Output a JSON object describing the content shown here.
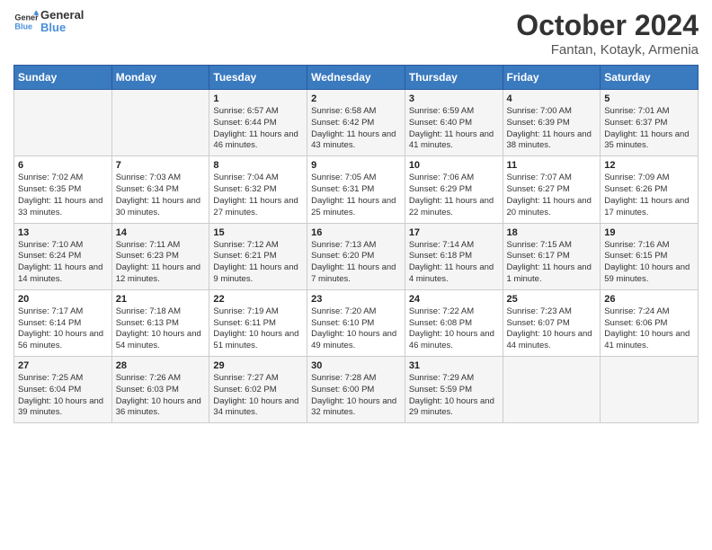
{
  "logo": {
    "line1": "General",
    "line2": "Blue"
  },
  "title": "October 2024",
  "subtitle": "Fantan, Kotayk, Armenia",
  "days_of_week": [
    "Sunday",
    "Monday",
    "Tuesday",
    "Wednesday",
    "Thursday",
    "Friday",
    "Saturday"
  ],
  "weeks": [
    [
      {
        "day": "",
        "info": ""
      },
      {
        "day": "",
        "info": ""
      },
      {
        "day": "1",
        "info": "Sunrise: 6:57 AM\nSunset: 6:44 PM\nDaylight: 11 hours and 46 minutes."
      },
      {
        "day": "2",
        "info": "Sunrise: 6:58 AM\nSunset: 6:42 PM\nDaylight: 11 hours and 43 minutes."
      },
      {
        "day": "3",
        "info": "Sunrise: 6:59 AM\nSunset: 6:40 PM\nDaylight: 11 hours and 41 minutes."
      },
      {
        "day": "4",
        "info": "Sunrise: 7:00 AM\nSunset: 6:39 PM\nDaylight: 11 hours and 38 minutes."
      },
      {
        "day": "5",
        "info": "Sunrise: 7:01 AM\nSunset: 6:37 PM\nDaylight: 11 hours and 35 minutes."
      }
    ],
    [
      {
        "day": "6",
        "info": "Sunrise: 7:02 AM\nSunset: 6:35 PM\nDaylight: 11 hours and 33 minutes."
      },
      {
        "day": "7",
        "info": "Sunrise: 7:03 AM\nSunset: 6:34 PM\nDaylight: 11 hours and 30 minutes."
      },
      {
        "day": "8",
        "info": "Sunrise: 7:04 AM\nSunset: 6:32 PM\nDaylight: 11 hours and 27 minutes."
      },
      {
        "day": "9",
        "info": "Sunrise: 7:05 AM\nSunset: 6:31 PM\nDaylight: 11 hours and 25 minutes."
      },
      {
        "day": "10",
        "info": "Sunrise: 7:06 AM\nSunset: 6:29 PM\nDaylight: 11 hours and 22 minutes."
      },
      {
        "day": "11",
        "info": "Sunrise: 7:07 AM\nSunset: 6:27 PM\nDaylight: 11 hours and 20 minutes."
      },
      {
        "day": "12",
        "info": "Sunrise: 7:09 AM\nSunset: 6:26 PM\nDaylight: 11 hours and 17 minutes."
      }
    ],
    [
      {
        "day": "13",
        "info": "Sunrise: 7:10 AM\nSunset: 6:24 PM\nDaylight: 11 hours and 14 minutes."
      },
      {
        "day": "14",
        "info": "Sunrise: 7:11 AM\nSunset: 6:23 PM\nDaylight: 11 hours and 12 minutes."
      },
      {
        "day": "15",
        "info": "Sunrise: 7:12 AM\nSunset: 6:21 PM\nDaylight: 11 hours and 9 minutes."
      },
      {
        "day": "16",
        "info": "Sunrise: 7:13 AM\nSunset: 6:20 PM\nDaylight: 11 hours and 7 minutes."
      },
      {
        "day": "17",
        "info": "Sunrise: 7:14 AM\nSunset: 6:18 PM\nDaylight: 11 hours and 4 minutes."
      },
      {
        "day": "18",
        "info": "Sunrise: 7:15 AM\nSunset: 6:17 PM\nDaylight: 11 hours and 1 minute."
      },
      {
        "day": "19",
        "info": "Sunrise: 7:16 AM\nSunset: 6:15 PM\nDaylight: 10 hours and 59 minutes."
      }
    ],
    [
      {
        "day": "20",
        "info": "Sunrise: 7:17 AM\nSunset: 6:14 PM\nDaylight: 10 hours and 56 minutes."
      },
      {
        "day": "21",
        "info": "Sunrise: 7:18 AM\nSunset: 6:13 PM\nDaylight: 10 hours and 54 minutes."
      },
      {
        "day": "22",
        "info": "Sunrise: 7:19 AM\nSunset: 6:11 PM\nDaylight: 10 hours and 51 minutes."
      },
      {
        "day": "23",
        "info": "Sunrise: 7:20 AM\nSunset: 6:10 PM\nDaylight: 10 hours and 49 minutes."
      },
      {
        "day": "24",
        "info": "Sunrise: 7:22 AM\nSunset: 6:08 PM\nDaylight: 10 hours and 46 minutes."
      },
      {
        "day": "25",
        "info": "Sunrise: 7:23 AM\nSunset: 6:07 PM\nDaylight: 10 hours and 44 minutes."
      },
      {
        "day": "26",
        "info": "Sunrise: 7:24 AM\nSunset: 6:06 PM\nDaylight: 10 hours and 41 minutes."
      }
    ],
    [
      {
        "day": "27",
        "info": "Sunrise: 7:25 AM\nSunset: 6:04 PM\nDaylight: 10 hours and 39 minutes."
      },
      {
        "day": "28",
        "info": "Sunrise: 7:26 AM\nSunset: 6:03 PM\nDaylight: 10 hours and 36 minutes."
      },
      {
        "day": "29",
        "info": "Sunrise: 7:27 AM\nSunset: 6:02 PM\nDaylight: 10 hours and 34 minutes."
      },
      {
        "day": "30",
        "info": "Sunrise: 7:28 AM\nSunset: 6:00 PM\nDaylight: 10 hours and 32 minutes."
      },
      {
        "day": "31",
        "info": "Sunrise: 7:29 AM\nSunset: 5:59 PM\nDaylight: 10 hours and 29 minutes."
      },
      {
        "day": "",
        "info": ""
      },
      {
        "day": "",
        "info": ""
      }
    ]
  ]
}
